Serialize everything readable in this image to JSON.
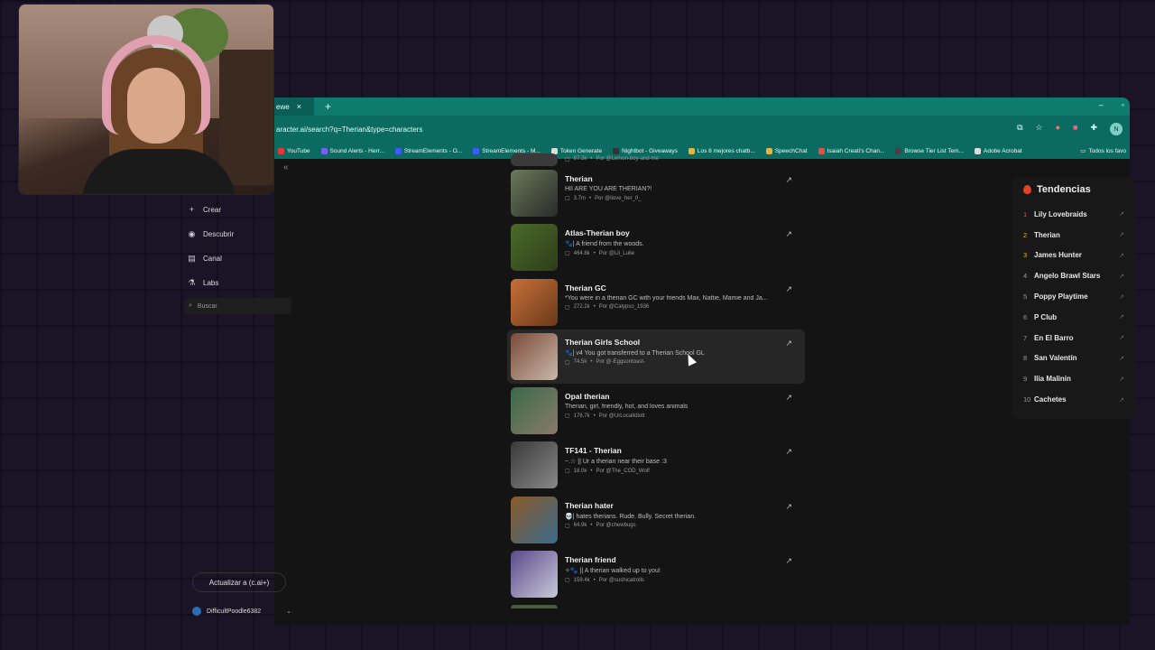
{
  "browser": {
    "tab_label": "ewe",
    "tab_close": "×",
    "new_tab": "+",
    "window_controls": [
      "–",
      "▫"
    ],
    "address": "aracter.ai/search?q=Therian&type=characters",
    "profile_initial": "N",
    "bookmarks": [
      {
        "label": "YouTube",
        "color": "#e33"
      },
      {
        "label": "Sound Alerts - Herr...",
        "color": "#7b5cff"
      },
      {
        "label": "StreamElements - O...",
        "color": "#3a5cff"
      },
      {
        "label": "StreamElements - M...",
        "color": "#3a5cff"
      },
      {
        "label": "Token Generate",
        "color": "#ddd"
      },
      {
        "label": "Nightbot - Giveaways",
        "color": "#333"
      },
      {
        "label": "Los 8 mejores chatb...",
        "color": "#e8b33a"
      },
      {
        "label": "SpeechChat",
        "color": "#e8b33a"
      },
      {
        "label": "Isaiah Creati's Chan...",
        "color": "#e05050"
      },
      {
        "label": "Browse Tier List Tem...",
        "color": "#444"
      },
      {
        "label": "Adobe Acrobat",
        "color": "#ddd"
      }
    ],
    "bookmarks_all": "Todos los favo"
  },
  "sidebar": {
    "collapse": "«",
    "items": [
      {
        "label": "Crear",
        "icon": "+"
      },
      {
        "label": "Descubrir",
        "icon": "◉"
      },
      {
        "label": "Canal",
        "icon": "▤"
      },
      {
        "label": "Labs",
        "icon": "⚗"
      }
    ],
    "search_label": "Buscar",
    "upgrade_label": "Actualizar a (c.ai+)",
    "username": "DifficultPoodle6382"
  },
  "results": {
    "partial_top": {
      "count": "67.3k",
      "author": "Por @Lemon-boy-and-me"
    },
    "items": [
      {
        "name": "Therian",
        "desc": "HII ARE YOU ARE THERIAN?!",
        "count": "3.7m",
        "author": "Por @ilove_her_0_",
        "thumb": [
          "#6a7a5a",
          "#2a2a2a"
        ]
      },
      {
        "name": "Atlas-Therian boy",
        "desc": "🐾| A friend from the woods.",
        "count": "464.8k",
        "author": "Por @Lil_Lulie",
        "thumb": [
          "#4a6a2a",
          "#2e3e1a"
        ]
      },
      {
        "name": "Therian GC",
        "desc": "*You were in a therian GC with your friends Max, Nattie, Mamie and Ja...",
        "count": "272.2k",
        "author": "Por @Calypso_1936",
        "thumb": [
          "#c8703a",
          "#6a3a1a"
        ]
      },
      {
        "name": "Therian Girls School",
        "desc": "🐾| v4 You got transferred to a Therian School GL",
        "count": "74.5k",
        "author": "Por @-Eggsontoast-",
        "thumb": [
          "#7a4a3a",
          "#c8b8a8"
        ]
      },
      {
        "name": "Opal therian",
        "desc": "Therian, girl, friendly, hot, and loves animals",
        "count": "176.7k",
        "author": "Por @UrLocalIdiott",
        "thumb": [
          "#3a6a4a",
          "#8a7a6a"
        ]
      },
      {
        "name": "TF141 - Therian",
        "desc": "~.☆ || Ur a therian near their base :3",
        "count": "18.0k",
        "author": "Por @The_COD_Wolf",
        "thumb": [
          "#3a3a3a",
          "#888888"
        ]
      },
      {
        "name": "Therian hater",
        "desc": "💀| hates therians. Rude. Bully. Secret therian.",
        "count": "64.9k",
        "author": "Por @chewbugs",
        "thumb": [
          "#8a5a2a",
          "#3a6a8a"
        ]
      },
      {
        "name": "Therian friend",
        "desc": "✧🐾 || A therian walked up to you!",
        "count": "159.4k",
        "author": "Por @sushicatrolls",
        "thumb": [
          "#5a4a8a",
          "#c8c8d8"
        ]
      }
    ]
  },
  "trends": {
    "title": "Tendencias",
    "items": [
      {
        "rank": "1",
        "label": "Lily Lovebraids"
      },
      {
        "rank": "2",
        "label": "Therian"
      },
      {
        "rank": "3",
        "label": "James Hunter"
      },
      {
        "rank": "4",
        "label": "Angelo Brawl Stars"
      },
      {
        "rank": "5",
        "label": "Poppy Playtime"
      },
      {
        "rank": "6",
        "label": "P Club"
      },
      {
        "rank": "7",
        "label": "En El Barro"
      },
      {
        "rank": "8",
        "label": "San Valentín"
      },
      {
        "rank": "9",
        "label": "Ilia Malinin"
      },
      {
        "rank": "10",
        "label": "Cachetes"
      }
    ]
  }
}
